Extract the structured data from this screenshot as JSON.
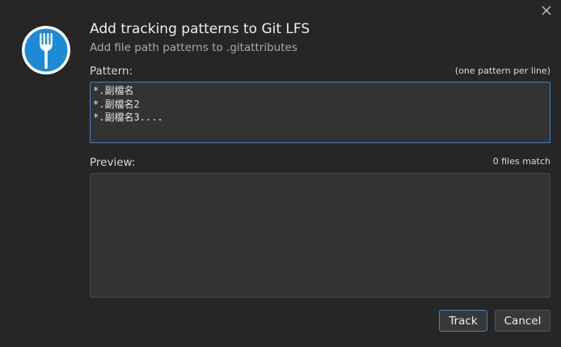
{
  "dialog": {
    "title": "Add tracking patterns to Git LFS",
    "subtitle": "Add file path patterns to .gitattributes",
    "close_icon": "close-icon",
    "logo_icon": "fork-logo-icon"
  },
  "pattern": {
    "label": "Pattern:",
    "hint": "(one pattern per line)",
    "value": "*.副檔名\n*.副檔名2\n*.副檔名3...."
  },
  "preview": {
    "label": "Preview:",
    "match_count": "0 files match"
  },
  "buttons": {
    "track_label": "Track",
    "cancel_label": "Cancel"
  },
  "colors": {
    "background": "#262626",
    "accent": "#3d86c9",
    "logo_blue": "#1e8ad6"
  }
}
